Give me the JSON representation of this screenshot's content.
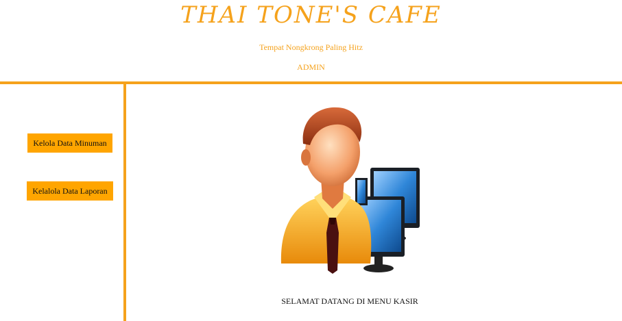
{
  "header": {
    "title": "THAI TONE'S CAFE",
    "tagline": "Tempat Nongkrong Paling Hitz",
    "role": "ADMIN"
  },
  "sidebar": {
    "items": [
      {
        "label": "Kelola Data Minuman"
      },
      {
        "label": "Kelalola Data Laporan"
      }
    ]
  },
  "main": {
    "illustration_icon": "cashier-user-computer-icon",
    "welcome_text": "SELAMAT DATANG DI MENU KASIR"
  },
  "colors": {
    "accent": "#f5a21c",
    "button_bg": "#ffa500"
  }
}
